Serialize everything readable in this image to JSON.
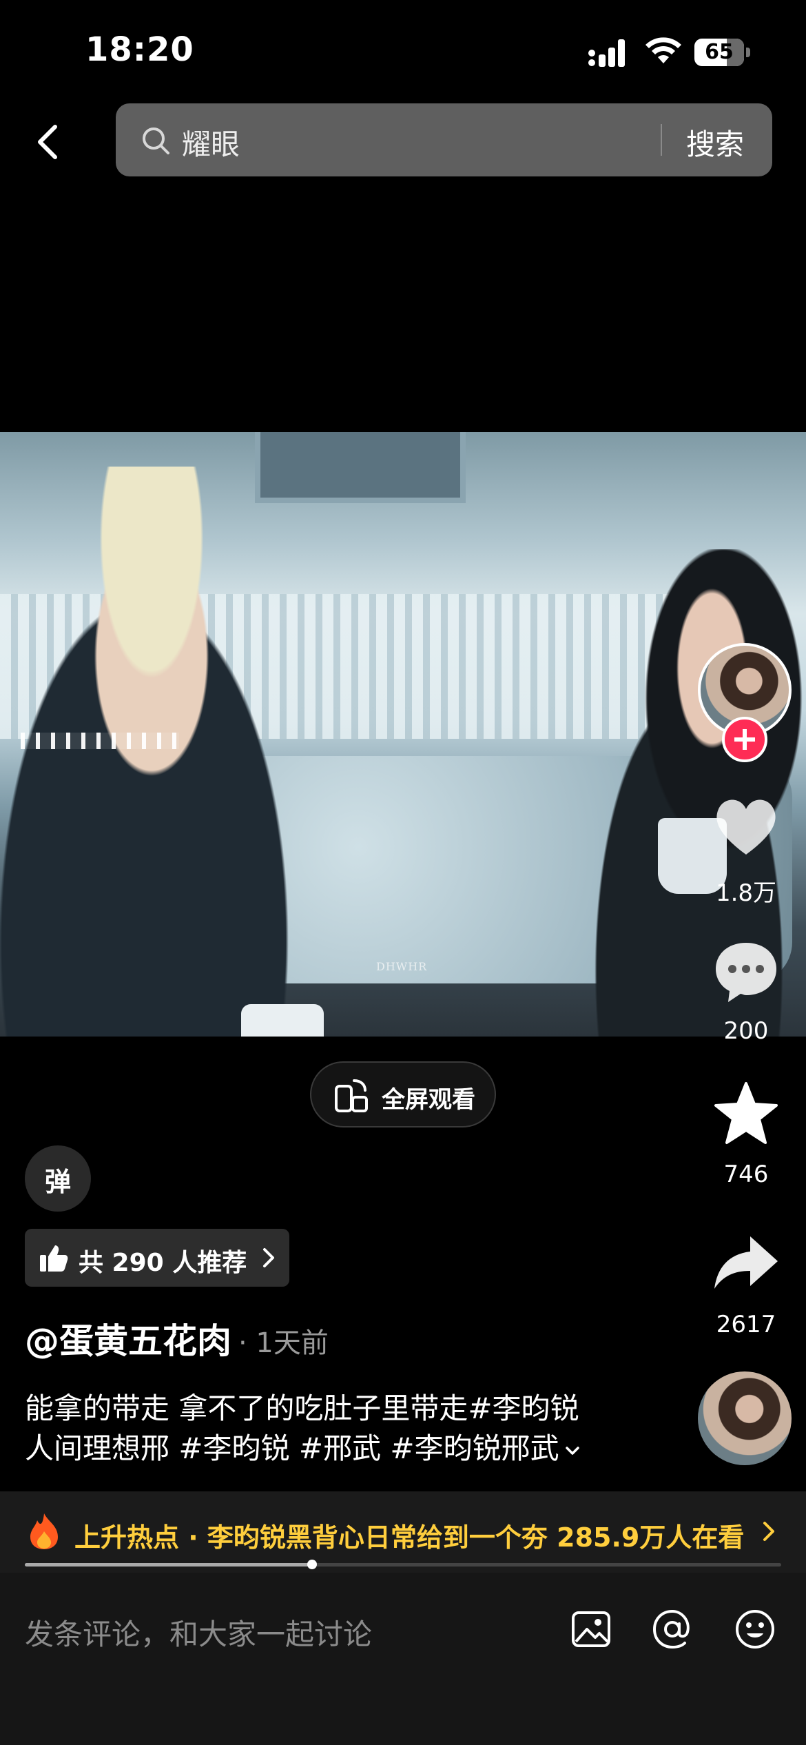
{
  "status_bar": {
    "time": "18:20",
    "battery": "65",
    "battery_level": 0.65
  },
  "search": {
    "query": "耀眼",
    "button_label": "搜索"
  },
  "video": {
    "watermark": "DHWHR"
  },
  "actions": {
    "likes": "1.8万",
    "comments": "200",
    "favorites": "746",
    "shares": "2617"
  },
  "fullscreen_label": "全屏观看",
  "danmaku_label": "弹",
  "recommend_label": "共 290 人推荐",
  "post": {
    "author": "@蛋黄五花肉",
    "time_ago": "· 1天前",
    "caption_line1": "能拿的带走 拿不了的吃肚子里带走#李昀锐",
    "caption_line2": "人间理想邢 #李昀锐 #邢武 #李昀锐邢武"
  },
  "hot_topic": "上升热点 · 李昀锐黑背心日常给到一个夯  285.9万人在看",
  "playback_progress": 0.38,
  "comment_placeholder": "发条评论，和大家一起讨论",
  "colors": {
    "accent_red": "#fe2c55",
    "hot_yellow": "#ffce3d"
  }
}
